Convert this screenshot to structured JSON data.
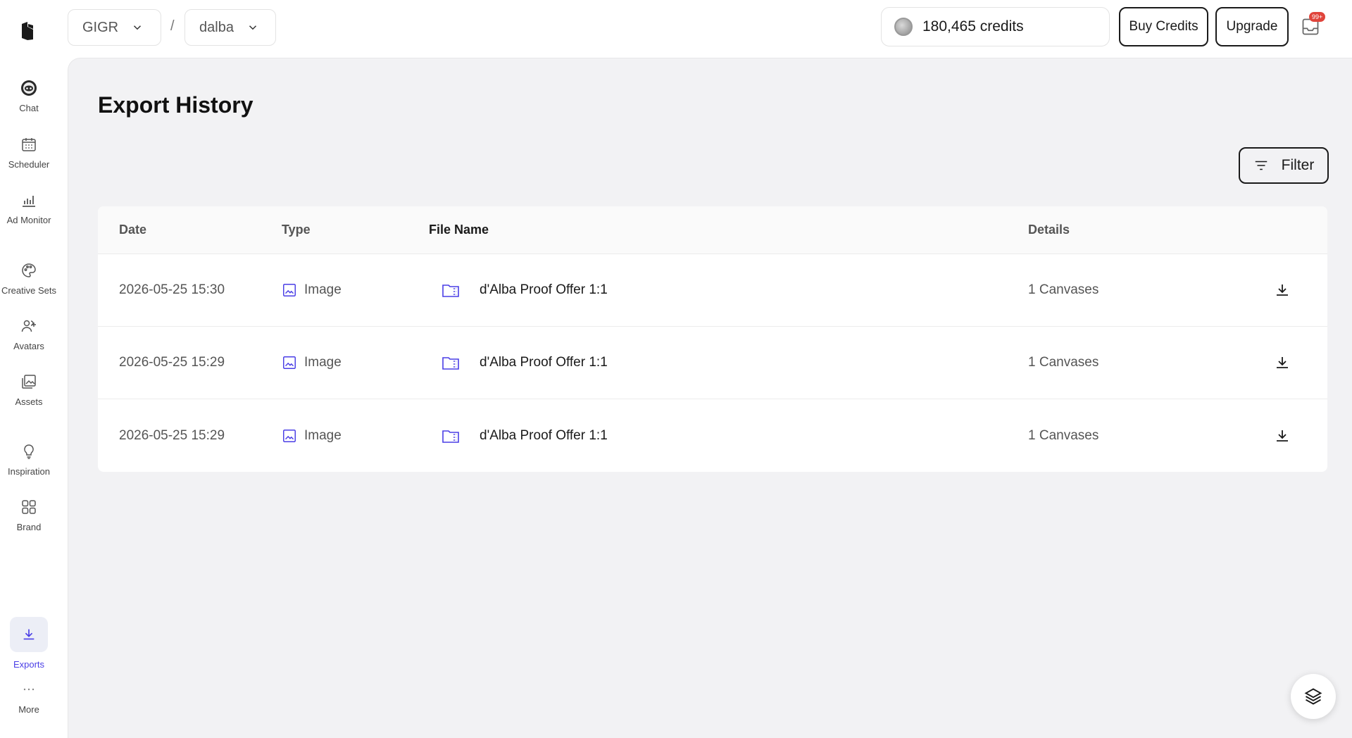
{
  "sidebar": {
    "items": [
      {
        "label": "Chat",
        "icon": "chat-bot-icon"
      },
      {
        "label": "Scheduler",
        "icon": "calendar-icon"
      },
      {
        "label": "Ad Monitor",
        "icon": "bar-chart-icon"
      },
      {
        "label": "Creative Sets",
        "icon": "palette-icon"
      },
      {
        "label": "Avatars",
        "icon": "users-add-icon"
      },
      {
        "label": "Assets",
        "icon": "image-stack-icon"
      },
      {
        "label": "Inspiration",
        "icon": "lightbulb-icon"
      },
      {
        "label": "Brand",
        "icon": "grid-icon"
      },
      {
        "label": "Exports",
        "icon": "download-icon",
        "active": true
      },
      {
        "label": "More",
        "icon": "more-dots-icon"
      }
    ],
    "accent_color": "#4a3ee6"
  },
  "topbar": {
    "workspace": "GIGR",
    "separator": "/",
    "brand": "dalba",
    "credits": "180,465 credits",
    "buy_credits": "Buy Credits",
    "upgrade": "Upgrade",
    "notification_badge": "99+"
  },
  "main": {
    "title": "Export History",
    "filter_label": "Filter",
    "table": {
      "columns": [
        "Date",
        "Type",
        "File Name",
        "Details"
      ],
      "rows": [
        {
          "date": "2026-05-25 15:30",
          "type": "Image",
          "file_name": "d'Alba Proof Offer 1:1",
          "details": "1 Canvases"
        },
        {
          "date": "2026-05-25 15:29",
          "type": "Image",
          "file_name": "d'Alba Proof Offer 1:1",
          "details": "1 Canvases"
        },
        {
          "date": "2026-05-25 15:29",
          "type": "Image",
          "file_name": "d'Alba Proof Offer 1:1",
          "details": "1 Canvases"
        }
      ]
    }
  }
}
